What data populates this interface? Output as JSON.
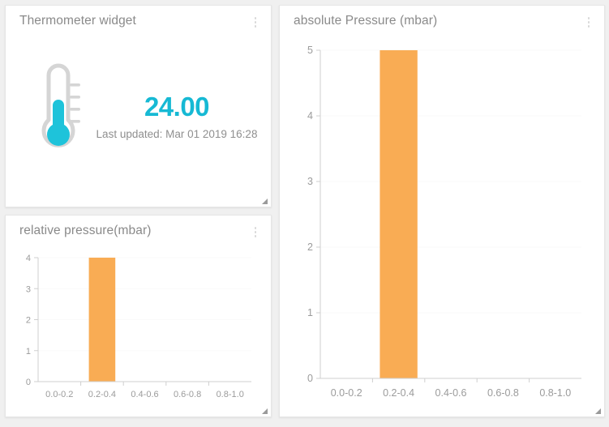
{
  "page": {
    "background_color": "#f0f0f0",
    "card_background": "#ffffff"
  },
  "colors": {
    "accent_cyan": "#16b9d4",
    "bar_orange": "#f9ac54",
    "title_gray": "#8a8a8a",
    "tick_gray": "#9b9b9b"
  },
  "cards": {
    "thermometer": {
      "title": "Thermometer widget",
      "menu_icon": "vertical-ellipsis-icon",
      "resize_icon": "resize-handle-icon",
      "value": "24.00",
      "last_updated": "Last updated: Mar 01 2019 16:28",
      "thermometer_icon": "thermometer-icon"
    },
    "absolute_pressure": {
      "title": "absolute Pressure (mbar)",
      "menu_icon": "vertical-ellipsis-icon",
      "resize_icon": "resize-handle-icon"
    },
    "relative_pressure": {
      "title": "relative pressure(mbar)",
      "menu_icon": "vertical-ellipsis-icon",
      "resize_icon": "resize-handle-icon"
    }
  },
  "chart_data": [
    {
      "id": "absolute-pressure-chart",
      "type": "bar",
      "title": "absolute Pressure (mbar)",
      "categories": [
        "0.0-0.2",
        "0.2-0.4",
        "0.4-0.6",
        "0.6-0.8",
        "0.8-1.0"
      ],
      "values": [
        0,
        5,
        0,
        0,
        0
      ],
      "xlabel": "",
      "ylabel": "",
      "ylim": [
        0,
        5
      ],
      "yticks": [
        0,
        1,
        2,
        3,
        4,
        5
      ],
      "ytick_labels": [
        "0",
        "1",
        "2",
        "3",
        "4",
        "5"
      ],
      "grid": true,
      "legend": false,
      "bar_color": "#f9ac54"
    },
    {
      "id": "relative-pressure-chart",
      "type": "bar",
      "title": "relative pressure(mbar)",
      "categories": [
        "0.0-0.2",
        "0.2-0.4",
        "0.4-0.6",
        "0.6-0.8",
        "0.8-1.0"
      ],
      "values": [
        0,
        4,
        0,
        0,
        0
      ],
      "xlabel": "",
      "ylabel": "",
      "ylim": [
        0,
        4
      ],
      "yticks": [
        0,
        1,
        2,
        3,
        4
      ],
      "ytick_labels": [
        "0",
        "1",
        "2",
        "3",
        "4"
      ],
      "grid": true,
      "legend": false,
      "bar_color": "#f9ac54"
    }
  ]
}
